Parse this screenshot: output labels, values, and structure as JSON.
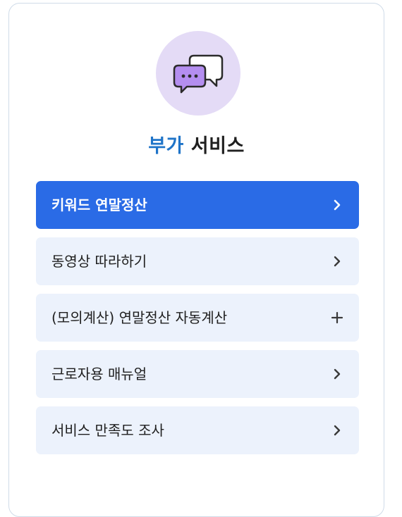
{
  "header": {
    "icon": "chat-bubbles-icon",
    "title_accent": "부가",
    "title_rest": "서비스"
  },
  "menu": {
    "items": [
      {
        "label": "키워드 연말정산",
        "icon": "chevron-right-icon",
        "active": true
      },
      {
        "label": "동영상 따라하기",
        "icon": "chevron-right-icon",
        "active": false
      },
      {
        "label": "(모의계산) 연말정산 자동계산",
        "icon": "plus-icon",
        "active": false
      },
      {
        "label": "근로자용 매뉴얼",
        "icon": "chevron-right-icon",
        "active": false
      },
      {
        "label": "서비스 만족도 조사",
        "icon": "chevron-right-icon",
        "active": false
      }
    ]
  },
  "colors": {
    "accent": "#1f74c8",
    "active_bg": "#2a6be6",
    "item_bg": "#ecf2fc",
    "icon_circle_bg": "#e4dbf6"
  }
}
